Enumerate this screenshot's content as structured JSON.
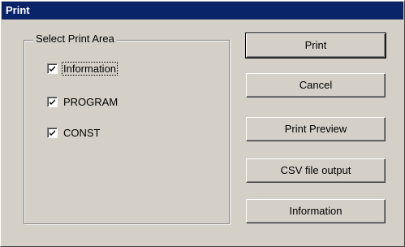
{
  "window": {
    "title": "Print"
  },
  "print_area": {
    "label": "Select Print Area",
    "items": [
      {
        "label": "Information",
        "checked": true
      },
      {
        "label": "PROGRAM",
        "checked": true
      },
      {
        "label": "CONST",
        "checked": true
      }
    ]
  },
  "buttons": {
    "print": "Print",
    "cancel": "Cancel",
    "print_preview": "Print Preview",
    "csv_output": "CSV file output",
    "information": "Information"
  }
}
